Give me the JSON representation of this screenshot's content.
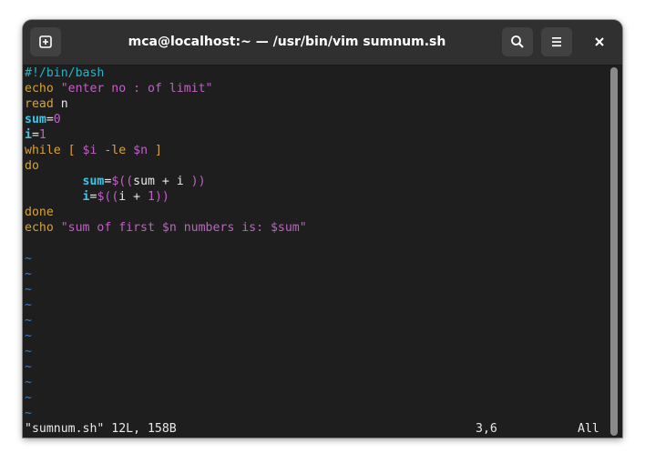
{
  "window": {
    "title": "mca@localhost:~ — /usr/bin/vim sumnum.sh"
  },
  "icons": {
    "new_tab": "new-tab-icon",
    "search": "search-icon",
    "menu": "hamburger-menu-icon",
    "close": "close-icon"
  },
  "colors": {
    "comment": "#2bb3c7",
    "keyword": "#d6a23c",
    "string": "#c060c6",
    "variable": "#3ec6e8",
    "tilde": "#2f7fd1",
    "background": "#1e1e1e"
  },
  "code": {
    "l1": "#!/bin/bash",
    "l2_kw": "echo",
    "l2_str": "\"enter no : of limit\"",
    "l3_kw": "read",
    "l3_rest": " n",
    "l4_var": "sum",
    "l4_eq": "=",
    "l4_num": "0",
    "l5_var": "i",
    "l5_eq": "=",
    "l5_num": "1",
    "l6_kw": "while",
    "l6_b1": " [ ",
    "l6_v1": "$i",
    "l6_op": " -le ",
    "l6_v2": "$n",
    "l6_b2": " ]",
    "l7_kw": "do",
    "l8_indent": "        ",
    "l8_var": "sum",
    "l8_eq": "=",
    "l8_op": "$((",
    "l8_expr": "sum + i ",
    "l8_cl": "))",
    "l9_indent": "        ",
    "l9_var": "i",
    "l9_eq": "=",
    "l9_op": "$((",
    "l9_expr": "i + ",
    "l9_num": "1",
    "l9_cl": "))",
    "l10_kw": "done",
    "l11_kw": "echo",
    "l11_s1": "\"sum of first ",
    "l11_v1": "$n",
    "l11_s2": " numbers is: ",
    "l11_v2": "$sum",
    "l11_s3": "\""
  },
  "tilde": "~",
  "status": {
    "file_info": "\"sumnum.sh\" 12L, 158B",
    "cursor": "3,6",
    "position": "All"
  }
}
